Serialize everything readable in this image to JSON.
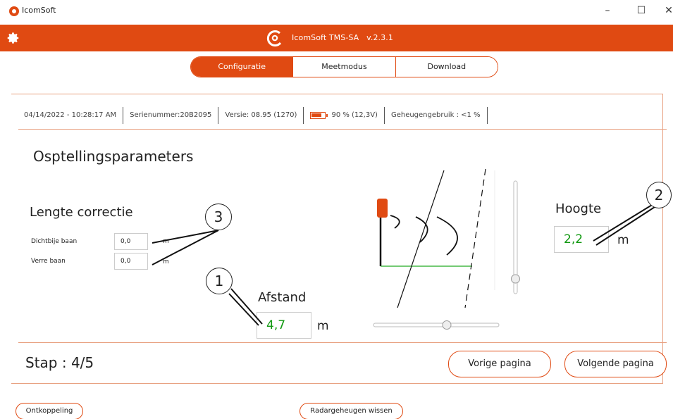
{
  "window": {
    "title": "IcomSoft"
  },
  "header": {
    "app_name": "IcomSoft TMS-SA",
    "version": "v.2.3.1"
  },
  "tabs": [
    {
      "label": "Configuratie",
      "active": true
    },
    {
      "label": "Meetmodus",
      "active": false
    },
    {
      "label": "Download",
      "active": false
    }
  ],
  "status": {
    "datetime": "04/14/2022 - 10:28:17 AM",
    "serial": "Serienummer:20B2095",
    "version": "Versie: 08.95 (1270)",
    "battery": "90 %  (12,3V)",
    "battery_level": 0.9,
    "memory": "Geheugengebruik : <1 %"
  },
  "main": {
    "title": "Osptellingsparameters",
    "lengte": {
      "title": "Lengte correctie",
      "near_label": "Dichtbije baan",
      "near_value": "0,0",
      "far_label": "Verre baan",
      "far_value": "0,0",
      "unit": "m"
    },
    "afstand": {
      "label": "Afstand",
      "value": "4,7",
      "unit": "m"
    },
    "hoogte": {
      "label": "Hoogte",
      "value": "2,2",
      "unit": "m"
    },
    "callouts": {
      "one": "1",
      "two": "2",
      "three": "3"
    }
  },
  "footer": {
    "step": "Stap : 4/5",
    "prev": "Vorige pagina",
    "next": "Volgende pagina",
    "disconnect": "Ontkoppeling",
    "clear_radar": "Radargeheugen wissen"
  },
  "colors": {
    "accent": "#e04a12",
    "value_green": "#119911"
  }
}
